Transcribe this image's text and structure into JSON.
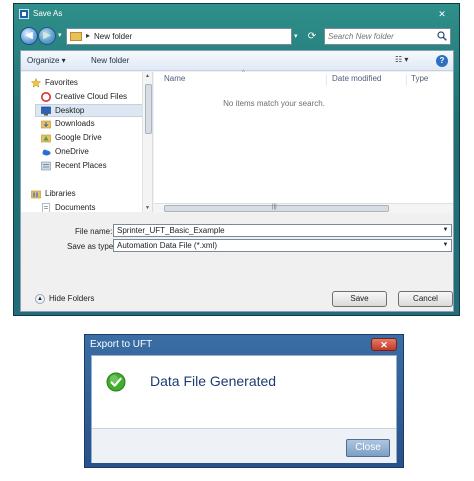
{
  "save_as": {
    "title": "Save As",
    "close_glyph": "✕",
    "address": {
      "path": "New folder"
    },
    "search": {
      "placeholder": "Search New folder"
    },
    "toolbar": {
      "organize_label": "Organize ▾",
      "new_folder_label": "New folder"
    },
    "nav": {
      "favorites_label": "Favorites",
      "favorites": [
        {
          "label": "Creative Cloud Files",
          "icon": "creative-cloud-icon"
        },
        {
          "label": "Desktop",
          "icon": "desktop-icon",
          "selected": true
        },
        {
          "label": "Downloads",
          "icon": "downloads-icon"
        },
        {
          "label": "Google Drive",
          "icon": "google-drive-icon"
        },
        {
          "label": "OneDrive",
          "icon": "onedrive-icon"
        },
        {
          "label": "Recent Places",
          "icon": "recent-places-icon"
        }
      ],
      "libraries_label": "Libraries",
      "libraries": [
        {
          "label": "Documents",
          "icon": "documents-icon"
        }
      ]
    },
    "columns": {
      "name": "Name",
      "date_modified": "Date modified",
      "type": "Type"
    },
    "empty_message": "No items match your search.",
    "file_name": {
      "label": "File name:",
      "value": "Sprinter_UFT_Basic_Example"
    },
    "save_as_type": {
      "label": "Save as type:",
      "value": "Automation Data File (*.xml)"
    },
    "hide_folders_label": "Hide Folders",
    "save_label": "Save",
    "cancel_label": "Cancel",
    "colors": {
      "frame": "#1f6f73",
      "selection": "#dde7f2"
    }
  },
  "export_uft": {
    "title": "Export to UFT",
    "close_glyph": "✕",
    "message": "Data File Generated",
    "close_label": "Close",
    "colors": {
      "title_bar": "#3a6ea5",
      "message": "#1e3b73",
      "check": "#3fae2a"
    }
  }
}
